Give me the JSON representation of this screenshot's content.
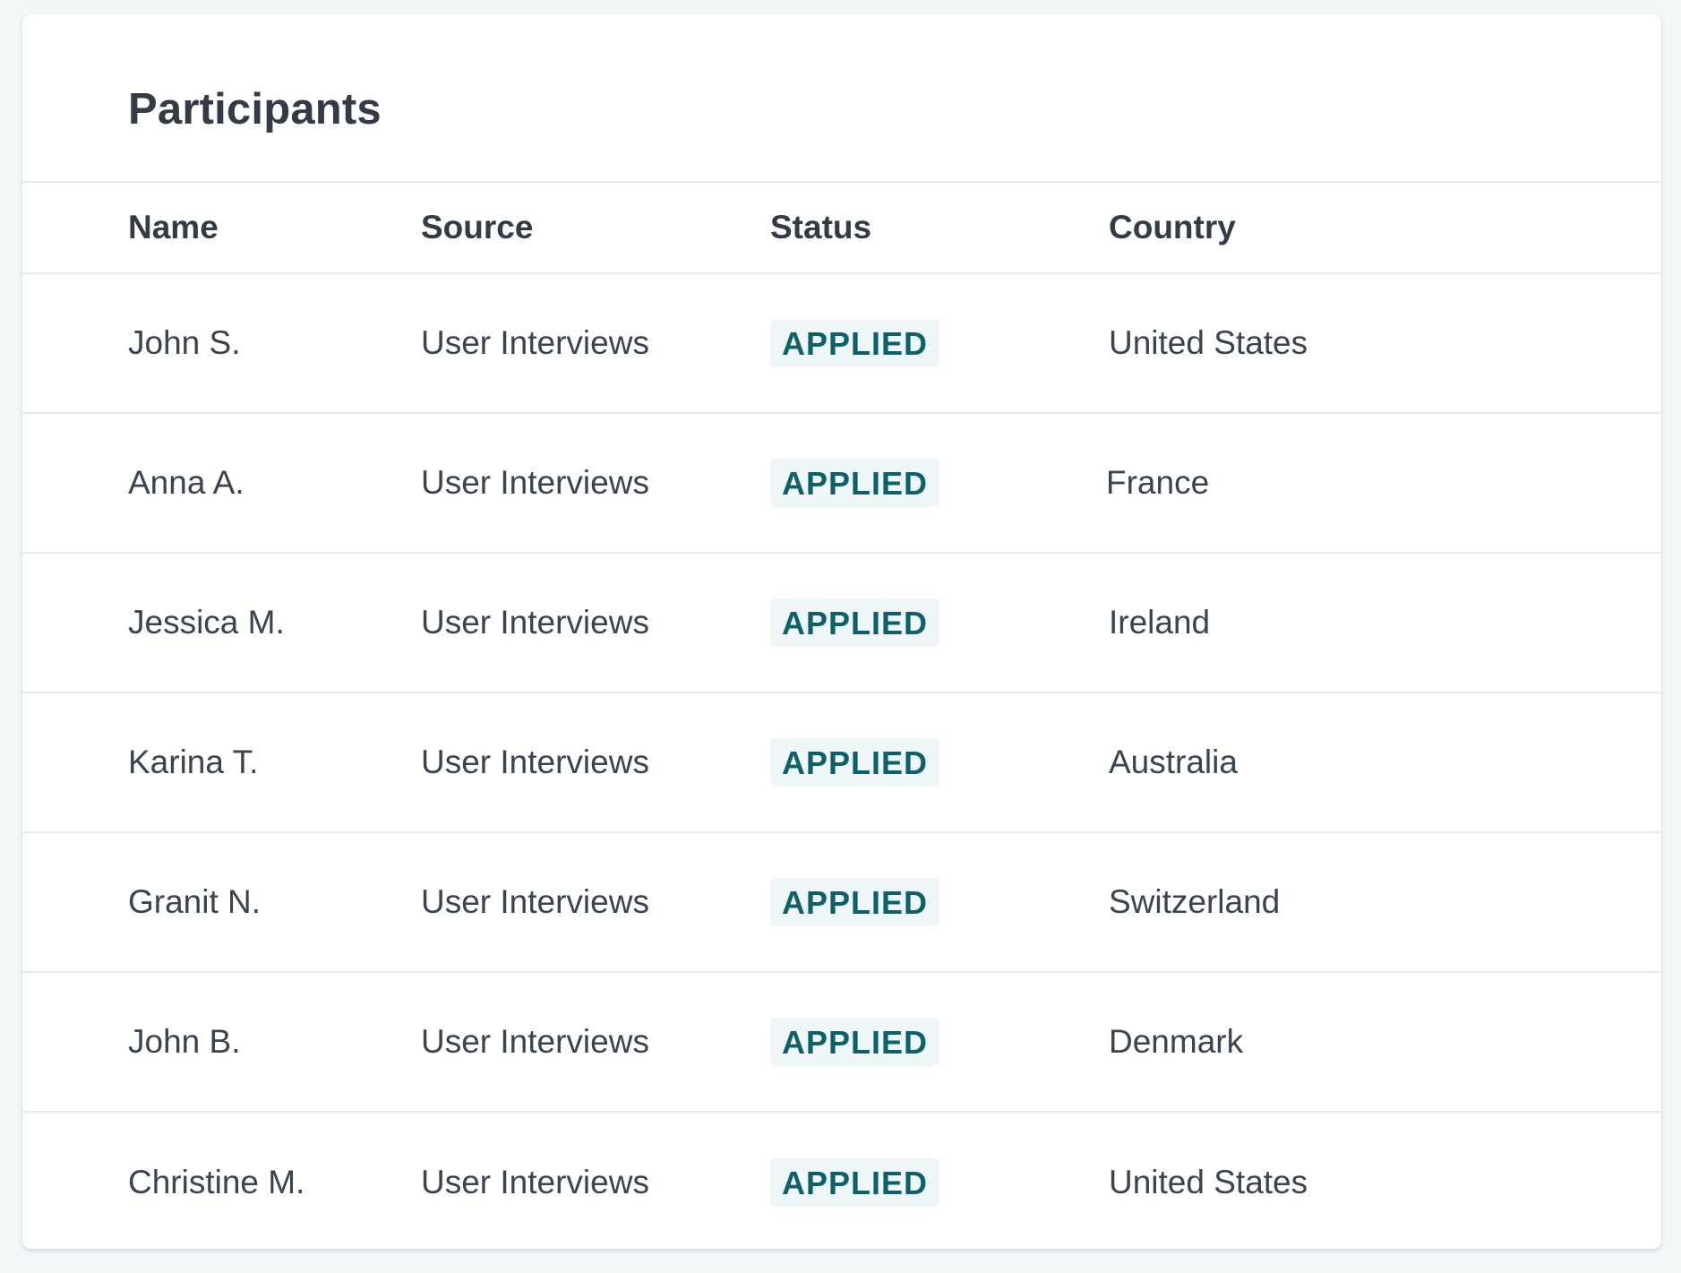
{
  "panel": {
    "title": "Participants"
  },
  "table": {
    "columns": [
      "Name",
      "Source",
      "Status",
      "Country"
    ],
    "rows": [
      {
        "name": "John S.",
        "source": "User Interviews",
        "status": "APPLIED",
        "country": "United States"
      },
      {
        "name": "Anna A.",
        "source": "User Interviews",
        "status": "APPLIED",
        "country": "France"
      },
      {
        "name": "Jessica M.",
        "source": "User Interviews",
        "status": "APPLIED",
        "country": "Ireland"
      },
      {
        "name": "Karina T.",
        "source": "User Interviews",
        "status": "APPLIED",
        "country": "Australia"
      },
      {
        "name": "Granit N.",
        "source": "User Interviews",
        "status": "APPLIED",
        "country": "Switzerland"
      },
      {
        "name": "John B.",
        "source": "User Interviews",
        "status": "APPLIED",
        "country": "Denmark"
      },
      {
        "name": "Christine M.",
        "source": "User Interviews",
        "status": "APPLIED",
        "country": "United States"
      }
    ]
  },
  "colors": {
    "status_text": "#0e6169",
    "status_background": "#eef6f7",
    "heading_text": "#343b46",
    "body_text": "#3b4350",
    "divider": "#e6e9ec"
  }
}
